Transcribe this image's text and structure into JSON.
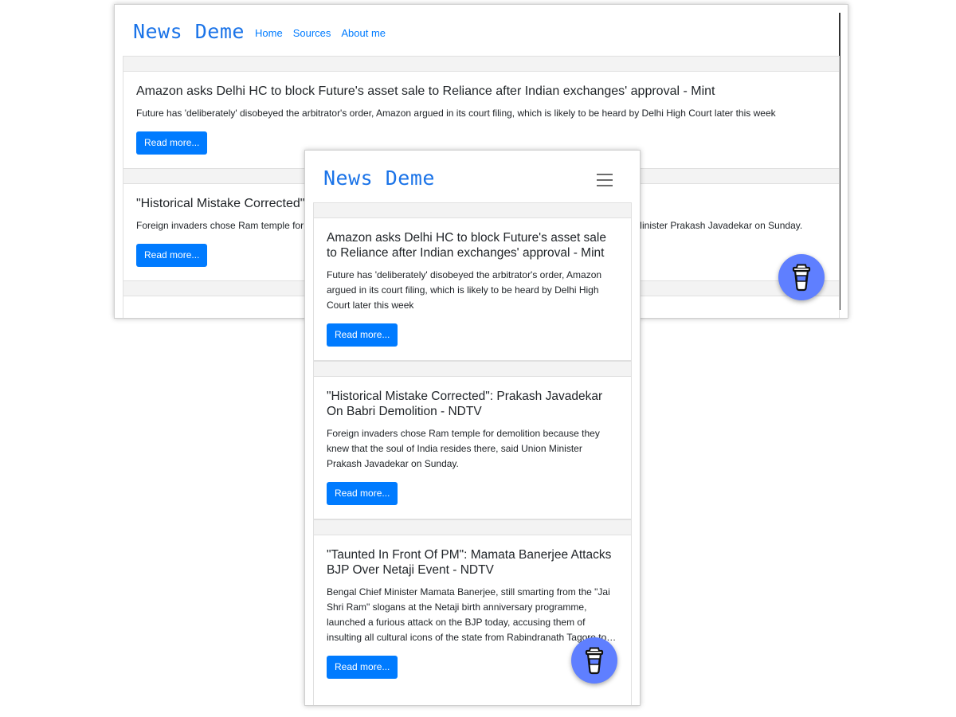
{
  "brand": "News Deme",
  "nav": {
    "home": "Home",
    "sources": "Sources",
    "about": "About me"
  },
  "articles": [
    {
      "title": "Amazon asks Delhi HC to block Future's asset sale to Reliance after Indian exchanges' approval - Mint",
      "description": "Future has 'deliberately' disobeyed the arbitrator's order, Amazon argued in its court filing, which is likely to be heard by Delhi High Court later this week",
      "button": "Read more..."
    },
    {
      "title": "\"Historical Mistake Corrected\": Prakash Javadekar On Babri Demolition - NDTV",
      "description": "Foreign invaders chose Ram temple for demolition because they knew that the soul of India resides there, said Union Minister Prakash Javadekar on Sunday.",
      "button": "Read more..."
    },
    {
      "title": "\"Taunted In Front Of PM\": Mamata Banerjee Attacks BJP Over Netaji Event - NDTV",
      "description": "Bengal Chief Minister Mamata Banerjee, still smarting from the \"Jai Shri Ram\" slogans at the Netaji birth anniversary programme, launched a furious attack on the BJP today, accusing them of insulting all cultural icons of the state from Rabindranath Tagore to…",
      "button": "Read more..."
    }
  ],
  "icons": {
    "menu": "hamburger-menu-icon",
    "coffee": "coffee-cup-icon"
  },
  "colors": {
    "brand": "#1a73e8",
    "link": "#007bff",
    "button": "#007bff",
    "coffee_button": "#5f7fff"
  }
}
